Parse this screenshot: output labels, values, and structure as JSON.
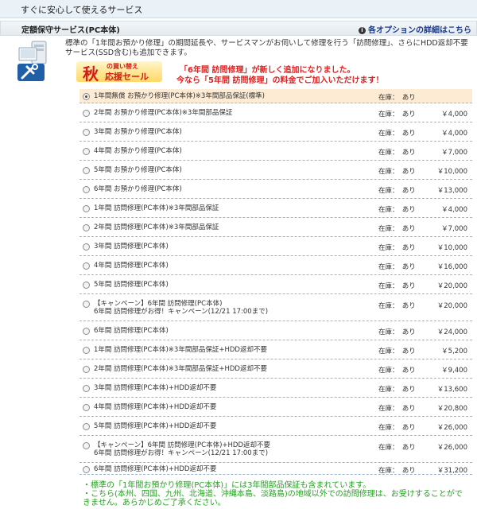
{
  "header": {
    "title": "すぐに安心して使えるサービス"
  },
  "section": {
    "title": "定額保守サービス(PC本体)",
    "detail_link": "各オプションの詳細はこちら",
    "detail_icon": "info-circle-icon"
  },
  "description": "標準の「1年間お預かり修理」の期間延長や、サービスマンがお伺いして修理を行う「訪問修理」、さらにHDD返却不要サービス(SSD含む)も追加できます。",
  "promo": {
    "badge_main": "秋",
    "badge_top": "の買い替え",
    "badge_bottom": "応援セール",
    "line1": "「6年間 訪問修理」が新しく追加になりました。",
    "line2": "今なら「5年間 訪問修理」の料金でご加入いただけます！"
  },
  "options": [
    {
      "name": "1年間無償 お預かり修理(PC本体)※3年間部品保証(標準)",
      "stock": "在庫：　あり",
      "price": "",
      "selected": true
    },
    {
      "name": "2年間 お預かり修理(PC本体)※3年間部品保証",
      "stock": "在庫：　あり",
      "price": "￥4,000"
    },
    {
      "name": "3年間 お預かり修理(PC本体)",
      "stock": "在庫：　あり",
      "price": "￥4,000"
    },
    {
      "name": "4年間 お預かり修理(PC本体)",
      "stock": "在庫：　あり",
      "price": "￥7,000"
    },
    {
      "name": "5年間 お預かり修理(PC本体)",
      "stock": "在庫：　あり",
      "price": "￥10,000"
    },
    {
      "name": "6年間 お預かり修理(PC本体)",
      "stock": "在庫：　あり",
      "price": "￥13,000"
    },
    {
      "name": "1年間 訪問修理(PC本体)※3年間部品保証",
      "stock": "在庫：　あり",
      "price": "￥4,000"
    },
    {
      "name": "2年間 訪問修理(PC本体)※3年間部品保証",
      "stock": "在庫：　あり",
      "price": "￥7,000"
    },
    {
      "name": "3年間 訪問修理(PC本体)",
      "stock": "在庫：　あり",
      "price": "￥10,000"
    },
    {
      "name": "4年間 訪問修理(PC本体)",
      "stock": "在庫：　あり",
      "price": "￥16,000"
    },
    {
      "name": "5年間 訪問修理(PC本体)",
      "stock": "在庫：　あり",
      "price": "￥20,000"
    },
    {
      "name": "【キャンペーン】6年間 訪問修理(PC本体)\n6年間 訪問修理がお得！キャンペーン(12/21 17:00まで)",
      "stock": "在庫：　あり",
      "price": "￥20,000"
    },
    {
      "name": "6年間 訪問修理(PC本体)",
      "stock": "在庫：　あり",
      "price": "￥24,000"
    },
    {
      "name": "1年間 訪問修理(PC本体)※3年間部品保証+HDD返却不要",
      "stock": "在庫：　あり",
      "price": "￥5,200"
    },
    {
      "name": "2年間 訪問修理(PC本体)※3年間部品保証+HDD返却不要",
      "stock": "在庫：　あり",
      "price": "￥9,400"
    },
    {
      "name": "3年間 訪問修理(PC本体)+HDD返却不要",
      "stock": "在庫：　あり",
      "price": "￥13,600"
    },
    {
      "name": "4年間 訪問修理(PC本体)+HDD返却不要",
      "stock": "在庫：　あり",
      "price": "￥20,800"
    },
    {
      "name": "5年間 訪問修理(PC本体)+HDD返却不要",
      "stock": "在庫：　あり",
      "price": "￥26,000"
    },
    {
      "name": "【キャンペーン】6年間 訪問修理(PC本体)+HDD返却不要\n6年間 訪問修理がお得！キャンペーン(12/21 17:00まで)",
      "stock": "在庫：　あり",
      "price": "￥26,000"
    },
    {
      "name": "6年間 訪問修理(PC本体)+HDD返却不要",
      "stock": "在庫：　あり",
      "price": "￥31,200"
    }
  ],
  "notes": [
    "・標準の「1年間お預かり修理(PC本体)」には3年間部品保証も含まれています。",
    "・こちら(本州、四国、九州、北海道、沖縄本島、淡路島)の地域以外での訪問修理は、お受けすることがで",
    "きません。あらかじめご了承ください。"
  ],
  "colors": {
    "accent_link": "#1a3a8a",
    "promo_red": "#e02020",
    "note_green": "#27a023",
    "selected_row": "#fdebd3"
  }
}
